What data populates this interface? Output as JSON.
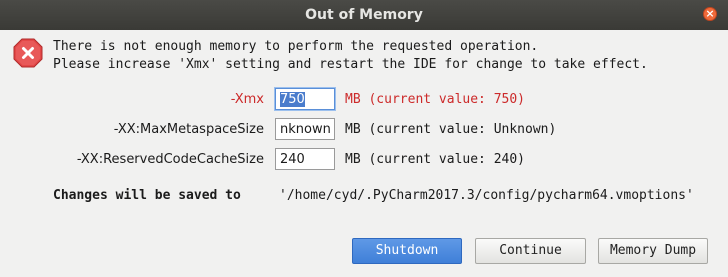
{
  "window": {
    "title": "Out of Memory",
    "close_glyph": "×"
  },
  "message": {
    "line1": "There is not enough memory to perform the requested operation.",
    "line2": "Please increase 'Xmx' setting and restart the IDE for change to take effect."
  },
  "settings": [
    {
      "label": "-Xmx",
      "value": "750",
      "suffix": "MB (current value: 750)",
      "highlight": true
    },
    {
      "label": "-XX:MaxMetaspaceSize",
      "value": "nknown",
      "suffix": "MB (current value: Unknown)",
      "highlight": false
    },
    {
      "label": "-XX:ReservedCodeCacheSize",
      "value": "240",
      "suffix": "MB (current value: 240)",
      "highlight": false
    }
  ],
  "save_info": {
    "label": "Changes will be saved to",
    "path": "'/home/cyd/.PyCharm2017.3/config/pycharm64.vmoptions'"
  },
  "buttons": {
    "shutdown": "Shutdown",
    "continue": "Continue",
    "memory_dump": "Memory Dump"
  },
  "colors": {
    "highlight_text": "#cc2a2a",
    "primary_button": "#4a86dd",
    "titlebar": "#3e3e3a",
    "error_icon": "#e34848"
  },
  "icons": {
    "error": "error-x-octagon-icon",
    "close": "close-icon"
  }
}
